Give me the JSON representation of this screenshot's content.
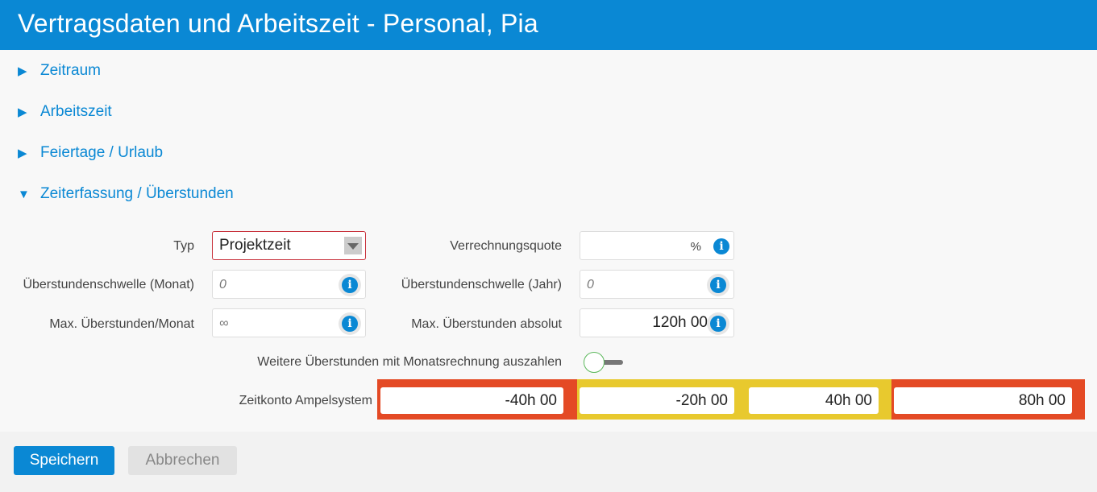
{
  "title": "Vertragsdaten und Arbeitszeit - Personal, Pia",
  "sections": [
    {
      "label": "Zeitraum",
      "arrow": "▶"
    },
    {
      "label": "Arbeitszeit",
      "arrow": "▶"
    },
    {
      "label": "Feiertage / Urlaub",
      "arrow": "▶"
    },
    {
      "label": "Zeiterfassung / Überstunden",
      "arrow": "▼"
    }
  ],
  "form": {
    "typ_label": "Typ",
    "typ_value": "Projektzeit",
    "verrechnungsquote_label": "Verrechnungsquote",
    "verrechnungsquote_unit": "%",
    "schwelle_monat_label": "Überstundenschwelle (Monat)",
    "schwelle_monat_placeholder": "0",
    "schwelle_jahr_label": "Überstundenschwelle (Jahr)",
    "schwelle_jahr_placeholder": "0",
    "max_monat_label": "Max. Überstunden/Monat",
    "max_monat_placeholder": "∞",
    "max_absolut_label": "Max. Überstunden absolut",
    "max_absolut_value": "120h 00",
    "auszahlen_label": "Weitere Überstunden mit Monatsrechnung auszahlen",
    "ampel_label": "Zeitkonto Ampelsystem",
    "ampel_values": [
      "-40h 00",
      "-20h 00",
      "40h 00",
      "80h 00"
    ],
    "info_glyph": "i"
  },
  "colors": {
    "accent": "#0a88d4",
    "ampel_red": "#e44a25",
    "ampel_yellow": "#e8c92e"
  },
  "buttons": {
    "save": "Speichern",
    "cancel": "Abbrechen"
  }
}
